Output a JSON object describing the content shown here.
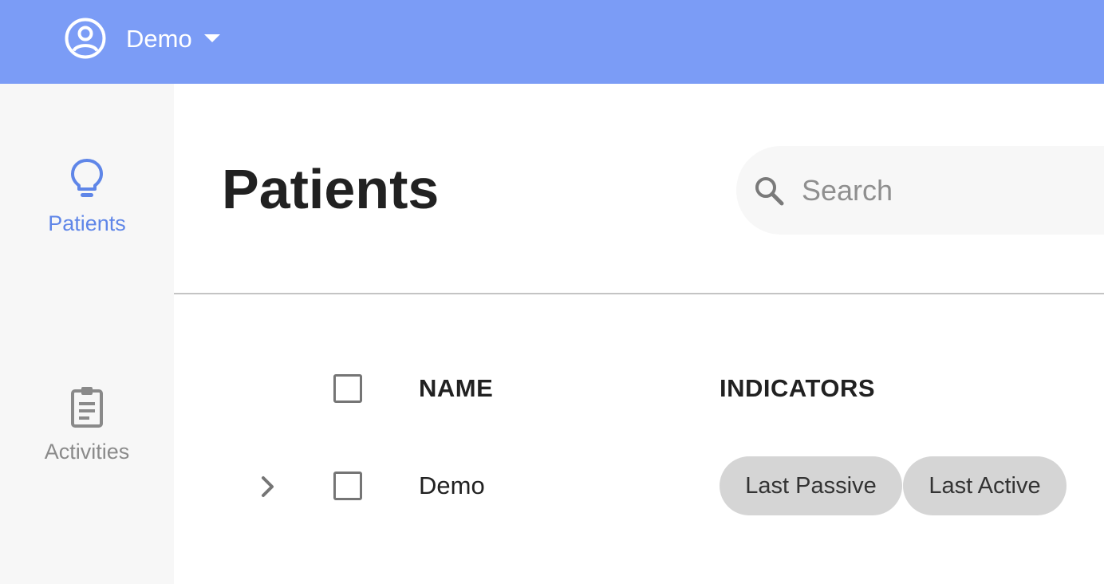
{
  "header": {
    "user_name": "Demo",
    "bg_color": "#7b9cf6"
  },
  "sidebar": {
    "items": [
      {
        "label": "Patients",
        "icon": "lightbulb-icon",
        "active": true,
        "color": "#5f86e8"
      },
      {
        "label": "Activities",
        "icon": "clipboard-icon",
        "active": false,
        "color": "#8a8a8a"
      }
    ]
  },
  "main": {
    "title": "Patients",
    "search": {
      "placeholder": "Search",
      "value": "",
      "icon": "search-icon"
    },
    "table": {
      "columns": [
        "NAME",
        "INDICATORS"
      ],
      "rows": [
        {
          "name": "Demo",
          "indicators": [
            "Last Passive",
            "Last Active"
          ],
          "selected": false,
          "expanded": false
        }
      ],
      "select_all": false
    }
  }
}
